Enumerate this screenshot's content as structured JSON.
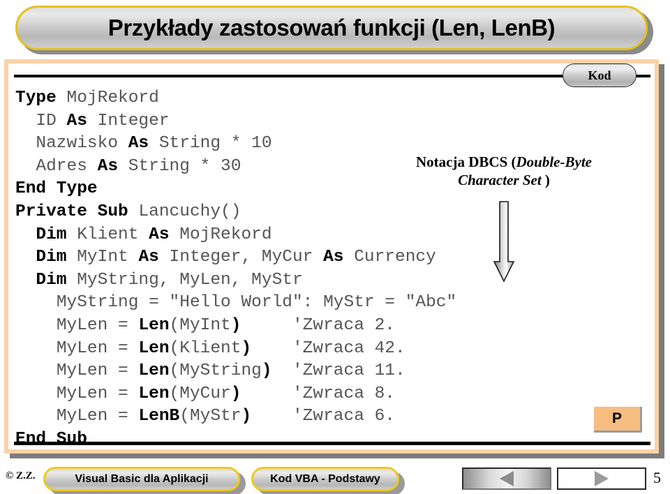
{
  "slide": {
    "title": "Przykłady zastosowań funkcji (Len, LenB)",
    "tab_label": "Kod",
    "p_badge": "P"
  },
  "annotation": {
    "line1_prefix": "Notacja DBCS (",
    "line1_italic": "Double-Byte",
    "line2_italic": "Character Set",
    "line2_suffix": " )",
    "arrow": "down-arrow"
  },
  "code": {
    "lines": [
      {
        "indent": 0,
        "segments": [
          {
            "t": "Type ",
            "b": true
          },
          {
            "t": "MojRekord",
            "b": false
          }
        ]
      },
      {
        "indent": 1,
        "segments": [
          {
            "t": "ID ",
            "b": false
          },
          {
            "t": "As ",
            "b": true
          },
          {
            "t": "Integer",
            "b": false
          }
        ]
      },
      {
        "indent": 1,
        "segments": [
          {
            "t": "Nazwisko ",
            "b": false
          },
          {
            "t": "As ",
            "b": true
          },
          {
            "t": "String * 10",
            "b": false
          }
        ]
      },
      {
        "indent": 1,
        "segments": [
          {
            "t": "Adres ",
            "b": false
          },
          {
            "t": "As ",
            "b": true
          },
          {
            "t": "String * 30",
            "b": false
          }
        ]
      },
      {
        "indent": 0,
        "segments": [
          {
            "t": "End Type",
            "b": true
          }
        ]
      },
      {
        "indent": 0,
        "segments": [
          {
            "t": "Private Sub ",
            "b": true
          },
          {
            "t": "Lancuchy()",
            "b": false
          }
        ]
      },
      {
        "indent": 1,
        "segments": [
          {
            "t": "Dim ",
            "b": true
          },
          {
            "t": "Klient ",
            "b": false
          },
          {
            "t": "As ",
            "b": true
          },
          {
            "t": "MojRekord",
            "b": false
          }
        ]
      },
      {
        "indent": 1,
        "segments": [
          {
            "t": "Dim ",
            "b": true
          },
          {
            "t": "MyInt ",
            "b": false
          },
          {
            "t": "As ",
            "b": true
          },
          {
            "t": "Integer, MyCur ",
            "b": false
          },
          {
            "t": "As ",
            "b": true
          },
          {
            "t": "Currency",
            "b": false
          }
        ]
      },
      {
        "indent": 1,
        "segments": [
          {
            "t": "Dim ",
            "b": true
          },
          {
            "t": "MyString, MyLen, MyStr",
            "b": false
          }
        ]
      },
      {
        "indent": 2,
        "segments": [
          {
            "t": "MyString = \"Hello World\": MyStr = \"Abc\"",
            "b": false
          }
        ]
      },
      {
        "indent": 2,
        "segments": [
          {
            "t": "MyLen = ",
            "b": false
          },
          {
            "t": "Len",
            "b": true
          },
          {
            "t": "(MyInt",
            "b": false
          },
          {
            "t": ")",
            "b": true
          },
          {
            "t": "     'Zwraca 2.",
            "b": false
          }
        ]
      },
      {
        "indent": 2,
        "segments": [
          {
            "t": "MyLen = ",
            "b": false
          },
          {
            "t": "Len",
            "b": true
          },
          {
            "t": "(Klient",
            "b": false
          },
          {
            "t": ")",
            "b": true
          },
          {
            "t": "    'Zwraca 42.",
            "b": false
          }
        ]
      },
      {
        "indent": 2,
        "segments": [
          {
            "t": "MyLen = ",
            "b": false
          },
          {
            "t": "Len",
            "b": true
          },
          {
            "t": "(MyString",
            "b": false
          },
          {
            "t": ")",
            "b": true
          },
          {
            "t": "  'Zwraca 11.",
            "b": false
          }
        ]
      },
      {
        "indent": 2,
        "segments": [
          {
            "t": "MyLen = ",
            "b": false
          },
          {
            "t": "Len",
            "b": true
          },
          {
            "t": "(MyCur",
            "b": false
          },
          {
            "t": ")",
            "b": true
          },
          {
            "t": "     'Zwraca 8.",
            "b": false
          }
        ]
      },
      {
        "indent": 2,
        "segments": [
          {
            "t": "MyLen = ",
            "b": false
          },
          {
            "t": "LenB",
            "b": true
          },
          {
            "t": "(MyStr",
            "b": false
          },
          {
            "t": ")",
            "b": true
          },
          {
            "t": "    'Zwraca 6.",
            "b": false
          }
        ]
      },
      {
        "indent": 0,
        "segments": [
          {
            "t": "End Sub",
            "b": true
          }
        ]
      }
    ]
  },
  "footer": {
    "copyright": "© Z.Z.",
    "button_left": "Visual Basic dla Aplikacji",
    "button_right": "Kod VBA - Podstawy",
    "prev_icon": "triangle-left-icon",
    "next_icon": "triangle-right-icon",
    "page_number": "5"
  },
  "colors": {
    "title_border": "#e5c11a",
    "frame_border": "#fbd2a7",
    "badge_bg": "#f7bd80",
    "shadow": "#7c7c7c",
    "code_text": "#555555"
  }
}
